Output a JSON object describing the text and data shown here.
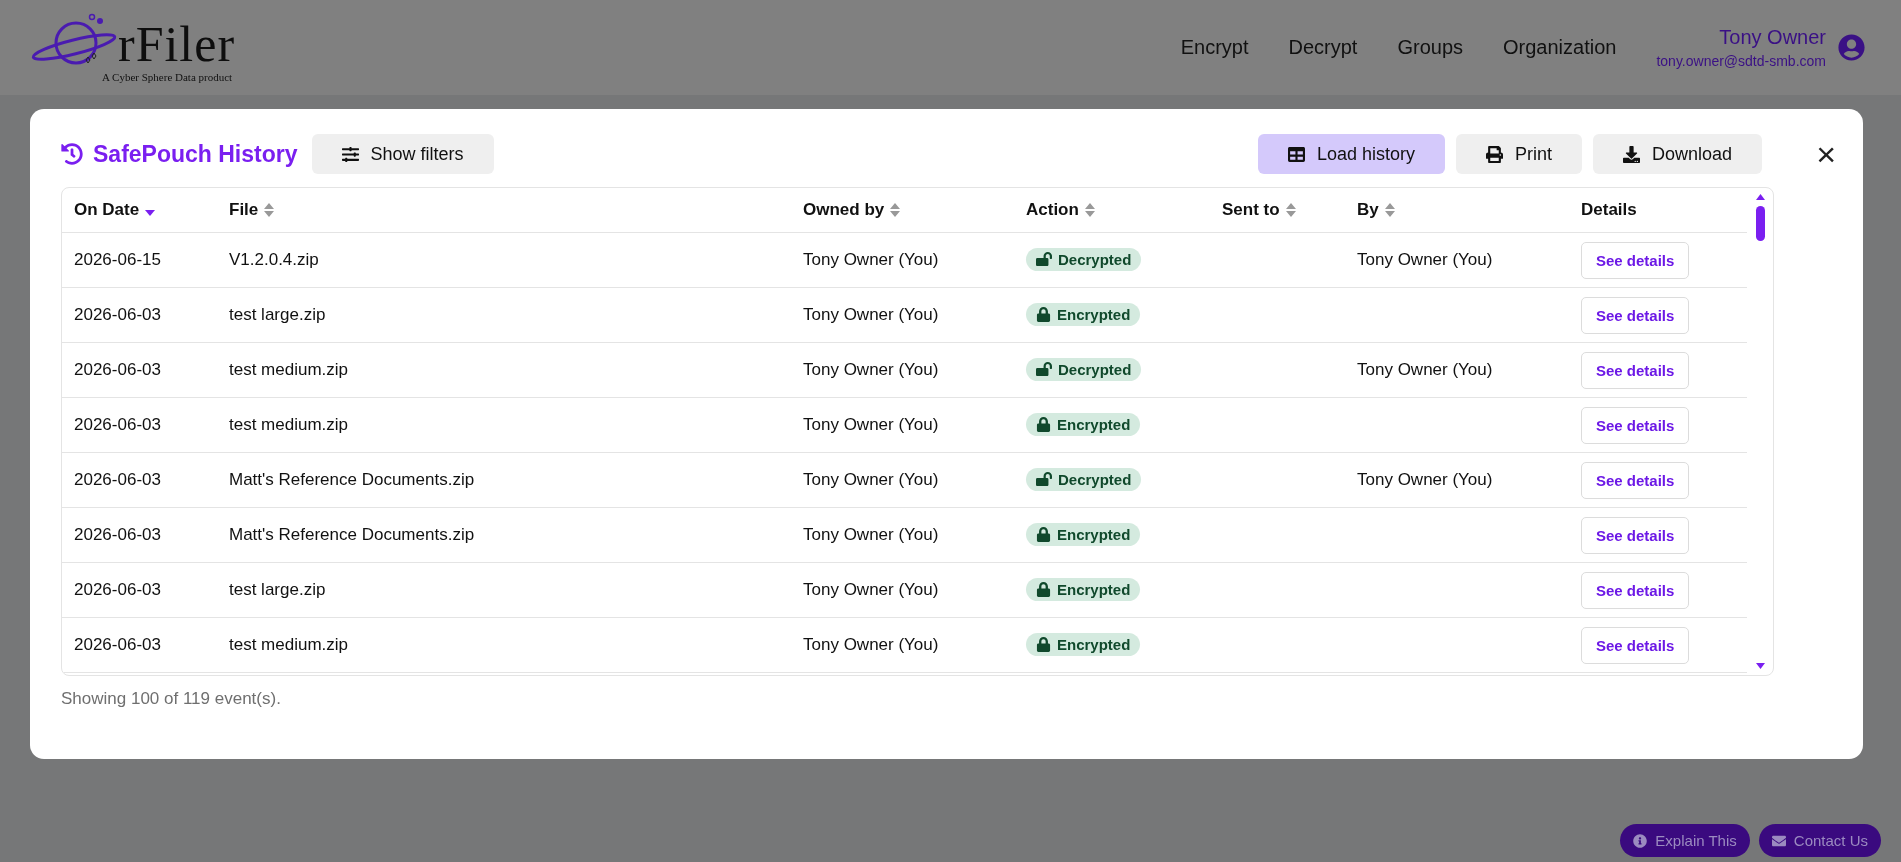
{
  "header": {
    "logo_text": "rFiler",
    "tagline": "A Cyber Sphere Data product",
    "nav": [
      "Encrypt",
      "Decrypt",
      "Groups",
      "Organization"
    ],
    "user": {
      "name": "Tony Owner",
      "email": "tony.owner@sdtd-smb.com"
    }
  },
  "modal": {
    "title": "SafePouch History",
    "filter_button": "Show filters",
    "actions": [
      {
        "label": "Load history",
        "kind": "load",
        "selected": true
      },
      {
        "label": "Print",
        "kind": "print",
        "selected": false
      },
      {
        "label": "Download",
        "kind": "download",
        "selected": false
      }
    ],
    "close": "×",
    "table": {
      "columns": [
        {
          "label": "On Date",
          "sortable": true,
          "selected": true
        },
        {
          "label": "File",
          "sortable": true,
          "selected": false
        },
        {
          "label": "Owned by",
          "sortable": true,
          "selected": false
        },
        {
          "label": "Action",
          "sortable": true,
          "selected": false
        },
        {
          "label": "Sent to",
          "sortable": true,
          "selected": false
        },
        {
          "label": "By",
          "sortable": true,
          "selected": false
        },
        {
          "label": "Details",
          "sortable": false,
          "selected": false
        }
      ],
      "rows": [
        {
          "date": "2026-06-15",
          "file": "V1.2.0.4.zip",
          "owned_by": "Tony Owner (You)",
          "action": {
            "kind": "decrypted",
            "label": "Decrypted"
          },
          "by": "Tony Owner (You)",
          "details": "See details"
        },
        {
          "date": "2026-06-03",
          "file": "test large.zip",
          "owned_by": "Tony Owner (You)",
          "action": {
            "kind": "encrypted",
            "label": "Encrypted"
          },
          "details": "See details"
        },
        {
          "date": "2026-06-03",
          "file": "test medium.zip",
          "owned_by": "Tony Owner (You)",
          "action": {
            "kind": "decrypted",
            "label": "Decrypted"
          },
          "by": "Tony Owner (You)",
          "details": "See details"
        },
        {
          "date": "2026-06-03",
          "file": "test medium.zip",
          "owned_by": "Tony Owner (You)",
          "action": {
            "kind": "encrypted",
            "label": "Encrypted"
          },
          "details": "See details"
        },
        {
          "date": "2026-06-03",
          "file": "Matt's Reference Documents.zip",
          "owned_by": "Tony Owner (You)",
          "action": {
            "kind": "decrypted",
            "label": "Decrypted"
          },
          "by": "Tony Owner (You)",
          "details": "See details"
        },
        {
          "date": "2026-06-03",
          "file": "Matt's Reference Documents.zip",
          "owned_by": "Tony Owner (You)",
          "action": {
            "kind": "encrypted",
            "label": "Encrypted"
          },
          "details": "See details"
        },
        {
          "date": "2026-06-03",
          "file": "test large.zip",
          "owned_by": "Tony Owner (You)",
          "action": {
            "kind": "encrypted",
            "label": "Encrypted"
          },
          "details": "See details"
        },
        {
          "date": "2026-06-03",
          "file": "test medium.zip",
          "owned_by": "Tony Owner (You)",
          "action": {
            "kind": "encrypted",
            "label": "Encrypted"
          },
          "details": "See details"
        }
      ]
    },
    "footer": "Showing 100 of 119 event(s)."
  },
  "help_buttons": [
    {
      "label": "Explain This",
      "kind": "info"
    },
    {
      "label": "Contact Us",
      "kind": "mail"
    }
  ]
}
